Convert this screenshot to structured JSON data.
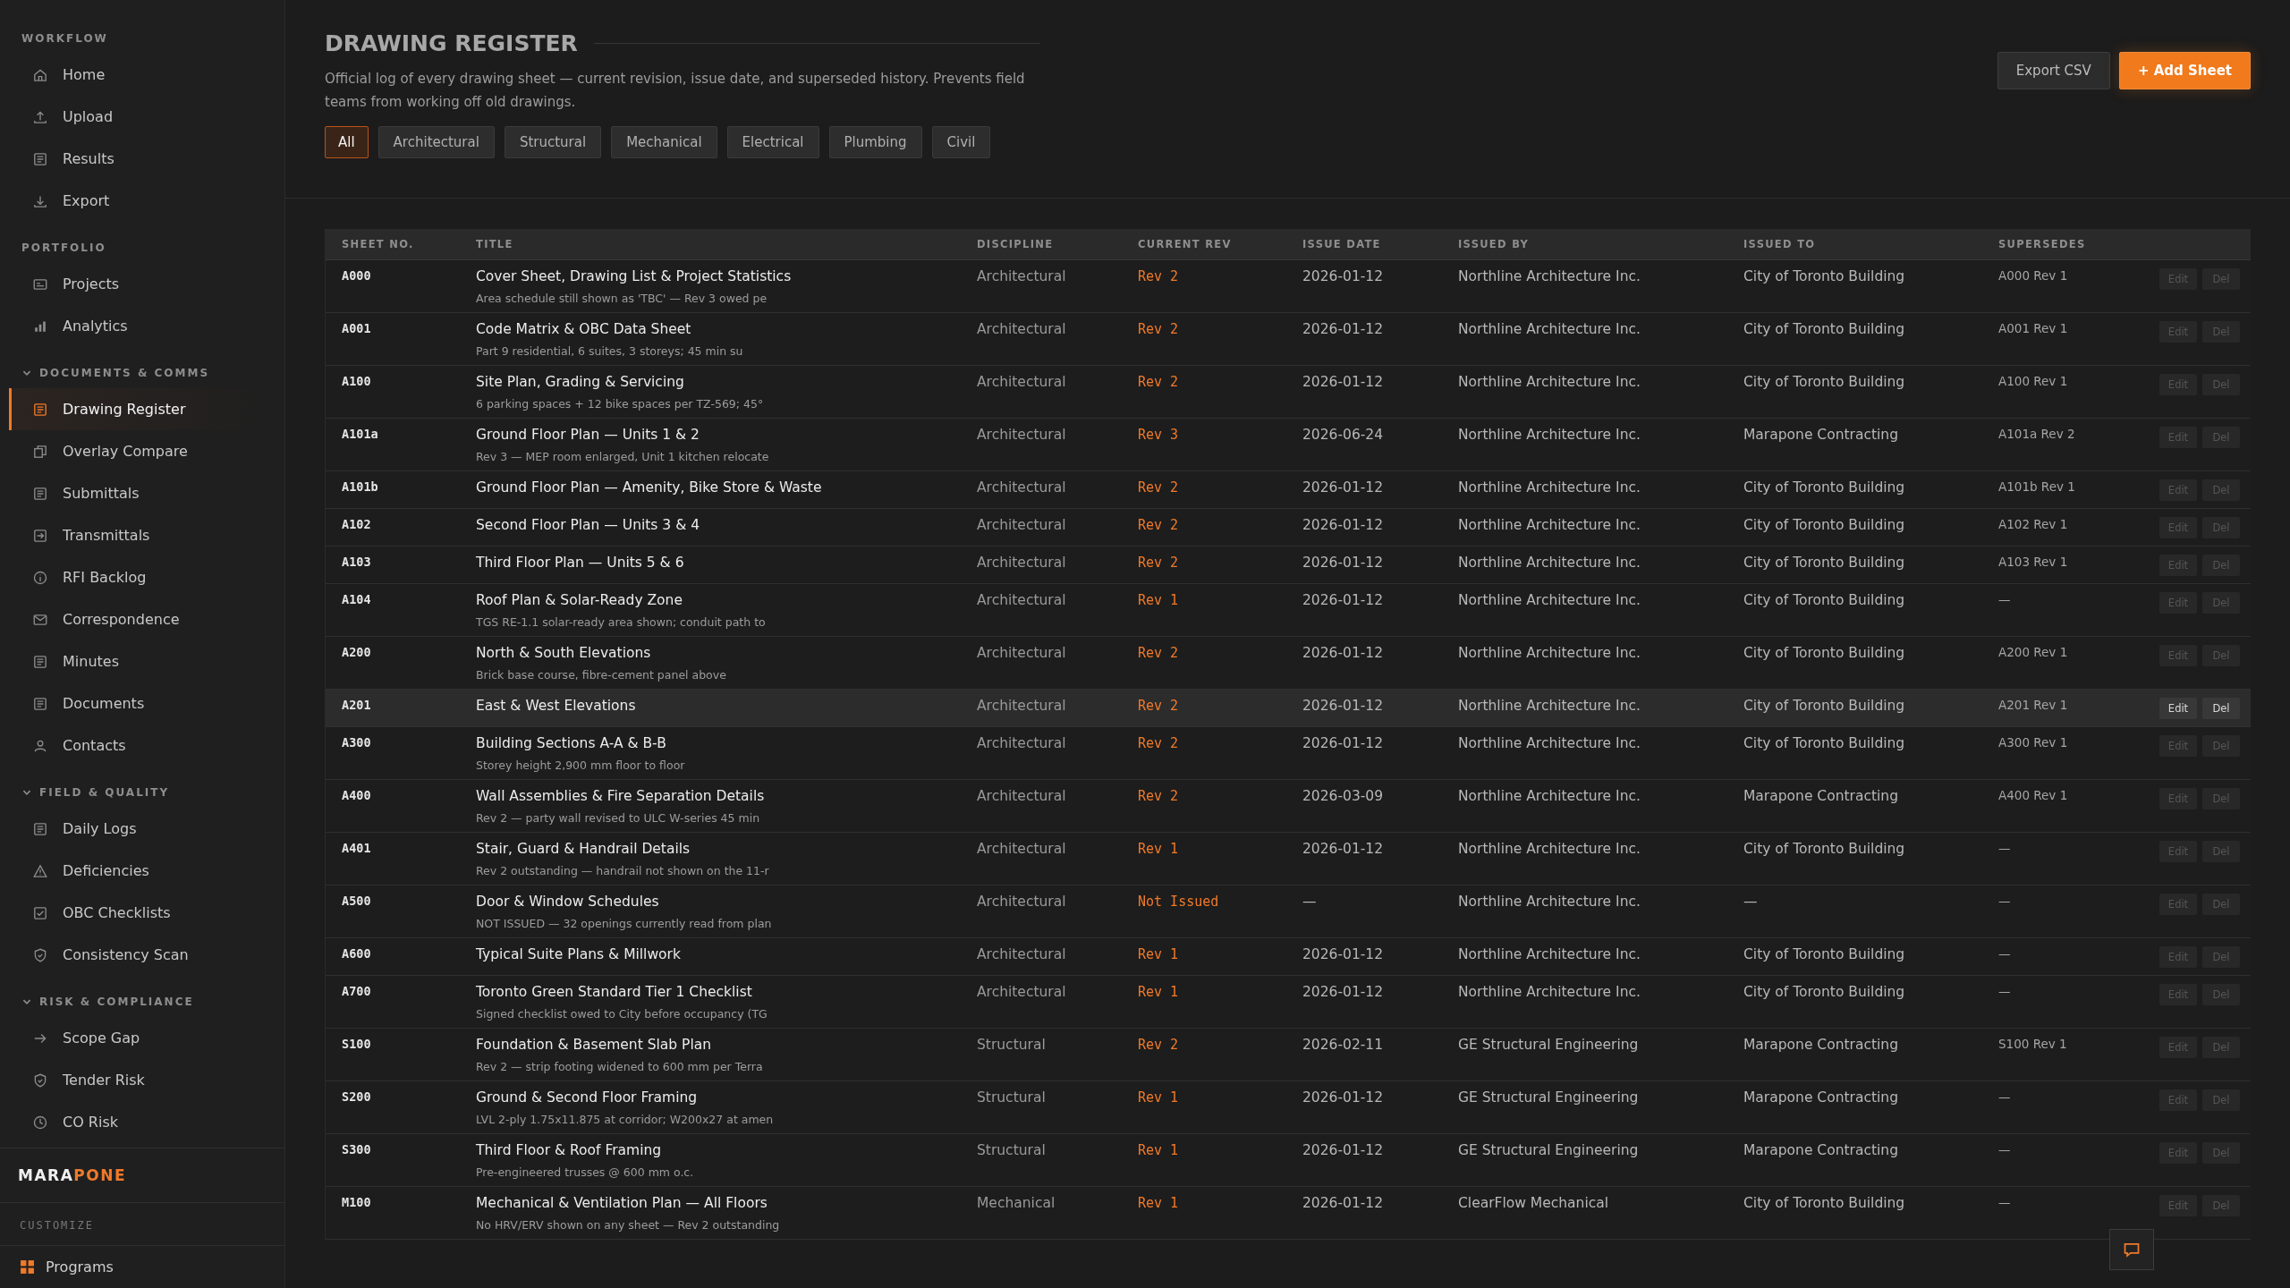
{
  "sidebar": {
    "sections": [
      {
        "label": "WORKFLOW",
        "items": [
          {
            "label": "Home",
            "selected": false
          },
          {
            "label": "Upload",
            "selected": false
          },
          {
            "label": "Results",
            "selected": false
          },
          {
            "label": "Export",
            "selected": false
          }
        ]
      },
      {
        "label": "PORTFOLIO",
        "items": [
          {
            "label": "Projects",
            "selected": false
          },
          {
            "label": "Analytics",
            "selected": false
          }
        ]
      },
      {
        "label": "DOCUMENTS & COMMS",
        "expanded": true,
        "items": [
          {
            "label": "Drawing Register",
            "selected": true
          },
          {
            "label": "Overlay Compare",
            "selected": false
          },
          {
            "label": "Submittals",
            "selected": false
          },
          {
            "label": "Transmittals",
            "selected": false
          },
          {
            "label": "RFI Backlog",
            "selected": false
          },
          {
            "label": "Correspondence",
            "selected": false
          },
          {
            "label": "Minutes",
            "selected": false
          },
          {
            "label": "Documents",
            "selected": false
          },
          {
            "label": "Contacts",
            "selected": false
          }
        ]
      },
      {
        "label": "FIELD & QUALITY",
        "expanded": true,
        "items": [
          {
            "label": "Daily Logs",
            "selected": false
          },
          {
            "label": "Deficiencies",
            "selected": false
          },
          {
            "label": "OBC Checklists",
            "selected": false
          },
          {
            "label": "Consistency Scan",
            "selected": false
          }
        ]
      },
      {
        "label": "RISK & COMPLIANCE",
        "expanded": true,
        "items": [
          {
            "label": "Scope Gap",
            "selected": false
          },
          {
            "label": "Tender Risk",
            "selected": false
          },
          {
            "label": "CO Risk",
            "selected": false
          }
        ]
      }
    ],
    "logo": {
      "part_1": "MARA",
      "part_2": "PONE"
    },
    "customize": {
      "label": "CUSTOMIZE",
      "items": [
        {
          "label": "Programs"
        }
      ]
    }
  },
  "header": {
    "title": "DRAWING REGISTER",
    "description": "Official log of every drawing sheet — current revision, issue date, and superseded history. Prevents field teams from working off old drawings.",
    "buttons": [
      {
        "label": "Export CSV",
        "kind": "secondary"
      },
      {
        "label": "+ Add Sheet",
        "kind": "primary"
      }
    ]
  },
  "filters": [
    {
      "label": "All",
      "selected": true
    },
    {
      "label": "Architectural",
      "selected": false
    },
    {
      "label": "Structural",
      "selected": false
    },
    {
      "label": "Mechanical",
      "selected": false
    },
    {
      "label": "Electrical",
      "selected": false
    },
    {
      "label": "Plumbing",
      "selected": false
    },
    {
      "label": "Civil",
      "selected": false
    }
  ],
  "table": {
    "columns": [
      "SHEET NO.",
      "TITLE",
      "DISCIPLINE",
      "CURRENT REV",
      "ISSUE DATE",
      "ISSUED BY",
      "ISSUED TO",
      "SUPERSEDES"
    ],
    "rows": [
      {
        "sheet": "A000",
        "title": "Cover Sheet, Drawing List & Project Statistics",
        "note": "Area schedule still shown as 'TBC' — Rev 3 owed pe",
        "discipline": "Architectural",
        "rev": "Rev 2",
        "date": "2026-01-12",
        "by": "Northline Architecture Inc.",
        "to": "City of Toronto Building",
        "supersedes": "A000 Rev 1",
        "actions": [
          "Edit",
          "Del"
        ],
        "highlighted": false
      },
      {
        "sheet": "A001",
        "title": "Code Matrix & OBC Data Sheet",
        "note": "Part 9 residential, 6 suites, 3 storeys; 45 min su",
        "discipline": "Architectural",
        "rev": "Rev 2",
        "date": "2026-01-12",
        "by": "Northline Architecture Inc.",
        "to": "City of Toronto Building",
        "supersedes": "A001 Rev 1",
        "actions": [
          "Edit",
          "Del"
        ],
        "highlighted": false
      },
      {
        "sheet": "A100",
        "title": "Site Plan, Grading & Servicing",
        "note": "6 parking spaces + 12 bike spaces per TZ-569; 45°",
        "discipline": "Architectural",
        "rev": "Rev 2",
        "date": "2026-01-12",
        "by": "Northline Architecture Inc.",
        "to": "City of Toronto Building",
        "supersedes": "A100 Rev 1",
        "actions": [
          "Edit",
          "Del"
        ],
        "highlighted": false
      },
      {
        "sheet": "A101a",
        "title": "Ground Floor Plan — Units 1 & 2",
        "note": "Rev 3 — MEP room enlarged, Unit 1 kitchen relocate",
        "discipline": "Architectural",
        "rev": "Rev 3",
        "date": "2026-06-24",
        "by": "Northline Architecture Inc.",
        "to": "Marapone Contracting",
        "supersedes": "A101a Rev 2",
        "actions": [
          "Edit",
          "Del"
        ],
        "highlighted": false
      },
      {
        "sheet": "A101b",
        "title": "Ground Floor Plan — Amenity, Bike Store & Waste",
        "discipline": "Architectural",
        "rev": "Rev 2",
        "date": "2026-01-12",
        "by": "Northline Architecture Inc.",
        "to": "City of Toronto Building",
        "supersedes": "A101b Rev 1",
        "actions": [
          "Edit",
          "Del"
        ],
        "highlighted": false
      },
      {
        "sheet": "A102",
        "title": "Second Floor Plan — Units 3 & 4",
        "discipline": "Architectural",
        "rev": "Rev 2",
        "date": "2026-01-12",
        "by": "Northline Architecture Inc.",
        "to": "City of Toronto Building",
        "supersedes": "A102 Rev 1",
        "actions": [
          "Edit",
          "Del"
        ],
        "highlighted": false
      },
      {
        "sheet": "A103",
        "title": "Third Floor Plan — Units 5 & 6",
        "discipline": "Architectural",
        "rev": "Rev 2",
        "date": "2026-01-12",
        "by": "Northline Architecture Inc.",
        "to": "City of Toronto Building",
        "supersedes": "A103 Rev 1",
        "actions": [
          "Edit",
          "Del"
        ],
        "highlighted": false
      },
      {
        "sheet": "A104",
        "title": "Roof Plan & Solar-Ready Zone",
        "note": "TGS RE-1.1 solar-ready area shown; conduit path to",
        "discipline": "Architectural",
        "rev": "Rev 1",
        "date": "2026-01-12",
        "by": "Northline Architecture Inc.",
        "to": "City of Toronto Building",
        "supersedes": "—",
        "actions": [
          "Edit",
          "Del"
        ],
        "highlighted": false
      },
      {
        "sheet": "A200",
        "title": "North & South Elevations",
        "note": "Brick base course, fibre-cement panel above",
        "discipline": "Architectural",
        "rev": "Rev 2",
        "date": "2026-01-12",
        "by": "Northline Architecture Inc.",
        "to": "City of Toronto Building",
        "supersedes": "A200 Rev 1",
        "actions": [
          "Edit",
          "Del"
        ],
        "highlighted": false
      },
      {
        "sheet": "A201",
        "title": "East & West Elevations",
        "discipline": "Architectural",
        "rev": "Rev 2",
        "date": "2026-01-12",
        "by": "Northline Architecture Inc.",
        "to": "City of Toronto Building",
        "supersedes": "A201 Rev 1",
        "actions": [
          "Edit",
          "Del"
        ],
        "highlighted": true
      },
      {
        "sheet": "A300",
        "title": "Building Sections A-A & B-B",
        "note": "Storey height 2,900 mm floor to floor",
        "discipline": "Architectural",
        "rev": "Rev 2",
        "date": "2026-01-12",
        "by": "Northline Architecture Inc.",
        "to": "City of Toronto Building",
        "supersedes": "A300 Rev 1",
        "actions": [
          "Edit",
          "Del"
        ],
        "highlighted": false
      },
      {
        "sheet": "A400",
        "title": "Wall Assemblies & Fire Separation Details",
        "note": "Rev 2 — party wall revised to ULC W-series 45 min",
        "discipline": "Architectural",
        "rev": "Rev 2",
        "date": "2026-03-09",
        "by": "Northline Architecture Inc.",
        "to": "Marapone Contracting",
        "supersedes": "A400 Rev 1",
        "actions": [
          "Edit",
          "Del"
        ],
        "highlighted": false
      },
      {
        "sheet": "A401",
        "title": "Stair, Guard & Handrail Details",
        "note": "Rev 2 outstanding — handrail not shown on the 11-r",
        "discipline": "Architectural",
        "rev": "Rev 1",
        "date": "2026-01-12",
        "by": "Northline Architecture Inc.",
        "to": "City of Toronto Building",
        "supersedes": "—",
        "actions": [
          "Edit",
          "Del"
        ],
        "highlighted": false
      },
      {
        "sheet": "A500",
        "title": "Door & Window Schedules",
        "note": "NOT ISSUED — 32 openings currently read from plan",
        "discipline": "Architectural",
        "rev": "Not Issued",
        "date": "—",
        "by": "Northline Architecture Inc.",
        "to": "—",
        "supersedes": "—",
        "actions": [
          "Edit",
          "Del"
        ],
        "highlighted": false
      },
      {
        "sheet": "A600",
        "title": "Typical Suite Plans & Millwork",
        "discipline": "Architectural",
        "rev": "Rev 1",
        "date": "2026-01-12",
        "by": "Northline Architecture Inc.",
        "to": "City of Toronto Building",
        "supersedes": "—",
        "actions": [
          "Edit",
          "Del"
        ],
        "highlighted": false
      },
      {
        "sheet": "A700",
        "title": "Toronto Green Standard Tier 1 Checklist",
        "note": "Signed checklist owed to City before occupancy (TG",
        "discipline": "Architectural",
        "rev": "Rev 1",
        "date": "2026-01-12",
        "by": "Northline Architecture Inc.",
        "to": "City of Toronto Building",
        "supersedes": "—",
        "actions": [
          "Edit",
          "Del"
        ],
        "highlighted": false
      },
      {
        "sheet": "S100",
        "title": "Foundation & Basement Slab Plan",
        "note": "Rev 2 — strip footing widened to 600 mm per Terra",
        "discipline": "Structural",
        "rev": "Rev 2",
        "date": "2026-02-11",
        "by": "GE Structural Engineering",
        "to": "Marapone Contracting",
        "supersedes": "S100 Rev 1",
        "actions": [
          "Edit",
          "Del"
        ],
        "highlighted": false
      },
      {
        "sheet": "S200",
        "title": "Ground & Second Floor Framing",
        "note": "LVL 2-ply 1.75x11.875 at corridor; W200x27 at amen",
        "discipline": "Structural",
        "rev": "Rev 1",
        "date": "2026-01-12",
        "by": "GE Structural Engineering",
        "to": "Marapone Contracting",
        "supersedes": "—",
        "actions": [
          "Edit",
          "Del"
        ],
        "highlighted": false
      },
      {
        "sheet": "S300",
        "title": "Third Floor & Roof Framing",
        "note": "Pre-engineered trusses @ 600 mm o.c.",
        "discipline": "Structural",
        "rev": "Rev 1",
        "date": "2026-01-12",
        "by": "GE Structural Engineering",
        "to": "Marapone Contracting",
        "supersedes": "—",
        "actions": [
          "Edit",
          "Del"
        ],
        "highlighted": false
      },
      {
        "sheet": "M100",
        "title": "Mechanical & Ventilation Plan — All Floors",
        "note": "No HRV/ERV shown on any sheet — Rev 2 outstanding",
        "discipline": "Mechanical",
        "rev": "Rev 1",
        "date": "2026-01-12",
        "by": "ClearFlow Mechanical",
        "to": "City of Toronto Building",
        "supersedes": "—",
        "actions": [
          "Edit",
          "Del"
        ],
        "highlighted": false
      }
    ]
  }
}
